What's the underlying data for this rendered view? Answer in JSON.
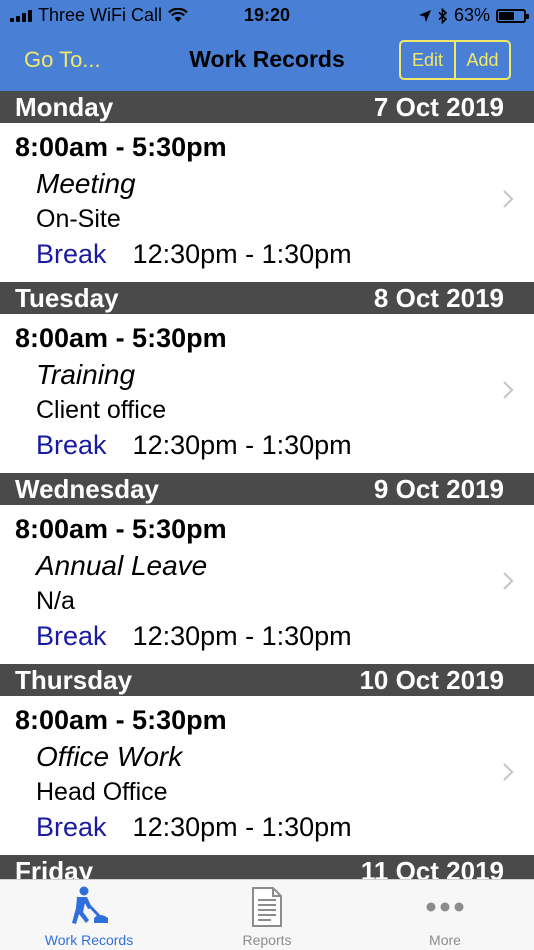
{
  "status_bar": {
    "carrier": "Three WiFi Call",
    "time": "19:20",
    "battery_text": "63%",
    "battery_level": 0.63,
    "signal_bars": 4
  },
  "nav": {
    "left_button": "Go To...",
    "title": "Work Records",
    "edit_button": "Edit",
    "add_button": "Add"
  },
  "days": [
    {
      "day": "Monday",
      "date": "7 Oct 2019",
      "hours": "8:00am - 5:30pm",
      "task": "Meeting",
      "location": "On-Site",
      "break_label": "Break",
      "break_time": "12:30pm - 1:30pm"
    },
    {
      "day": "Tuesday",
      "date": "8 Oct 2019",
      "hours": "8:00am - 5:30pm",
      "task": "Training",
      "location": "Client office",
      "break_label": "Break",
      "break_time": "12:30pm - 1:30pm"
    },
    {
      "day": "Wednesday",
      "date": "9 Oct 2019",
      "hours": "8:00am - 5:30pm",
      "task": "Annual Leave",
      "location": "N/a",
      "break_label": "Break",
      "break_time": "12:30pm - 1:30pm"
    },
    {
      "day": "Thursday",
      "date": "10 Oct 2019",
      "hours": "8:00am - 5:30pm",
      "task": "Office Work",
      "location": "Head Office",
      "break_label": "Break",
      "break_time": "12:30pm - 1:30pm"
    },
    {
      "day": "Friday",
      "date": "11 Oct 2019"
    }
  ],
  "tabs": [
    {
      "label": "Work Records",
      "icon": "worker-icon",
      "active": true
    },
    {
      "label": "Reports",
      "icon": "document-icon",
      "active": false
    },
    {
      "label": "More",
      "icon": "more-icon",
      "active": false
    }
  ],
  "colors": {
    "nav_background": "#4a7fd6",
    "nav_button_text": "#f2e86a",
    "day_header_background": "#4a4a4a",
    "break_label": "#1a1aa0",
    "active_tab": "#2f6fdc"
  }
}
